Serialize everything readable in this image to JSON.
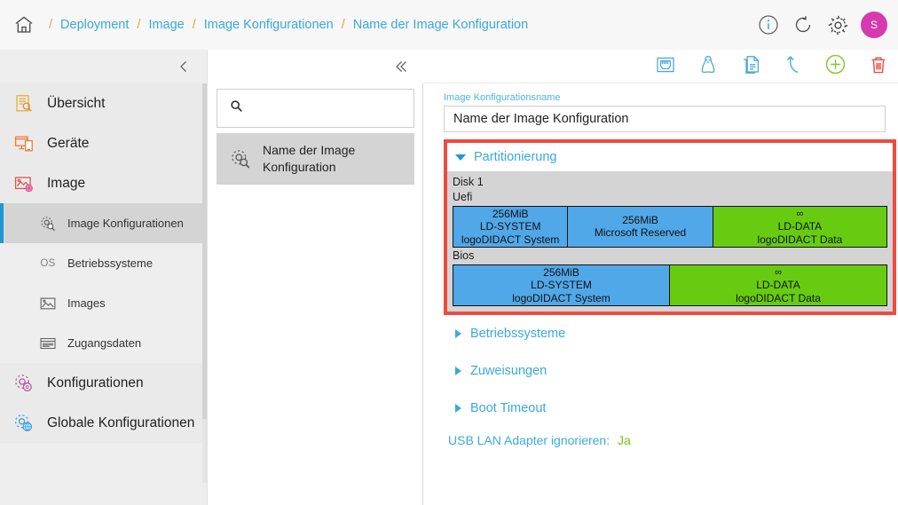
{
  "topbar": {
    "home_icon": "home-icon",
    "breadcrumbs": [
      {
        "label": "Deployment"
      },
      {
        "label": "Image"
      },
      {
        "label": "Image Konfigurationen"
      },
      {
        "label": "Name der Image Konfiguration"
      }
    ],
    "separator": "/",
    "actions": [
      {
        "icon": "info-icon"
      },
      {
        "icon": "refresh-icon"
      },
      {
        "icon": "gear-icon"
      }
    ],
    "avatar_initial": "S",
    "avatar_color": "#d63ab0"
  },
  "sidebar": {
    "collapse_icon": "chevron-left-icon",
    "items": [
      {
        "label": "Übersicht",
        "icon": "overview-document-search-icon",
        "level": "top"
      },
      {
        "label": "Geräte",
        "icon": "devices-monitor-phone-icon",
        "level": "top"
      },
      {
        "label": "Image",
        "icon": "image-gear-icon",
        "level": "top"
      },
      {
        "label": "Image Konfigurationen",
        "icon": "gear-search-icon",
        "level": "sub",
        "active": true
      },
      {
        "label": "Betriebssysteme",
        "icon": "os-text-icon",
        "level": "sub",
        "active": false
      },
      {
        "label": "Images",
        "icon": "picture-frame-icon",
        "level": "sub",
        "active": false
      },
      {
        "label": "Zugangsdaten",
        "icon": "credentials-card-icon",
        "level": "sub",
        "active": false
      },
      {
        "label": "Konfigurationen",
        "icon": "config-gear-icon",
        "level": "top"
      },
      {
        "label": "Globale Konfigurationen",
        "icon": "global-gear-globe-icon",
        "level": "top"
      }
    ]
  },
  "list_panel": {
    "collapse_icon": "chevron-left-icon",
    "search": {
      "icon": "search-icon",
      "value": "",
      "placeholder": ""
    },
    "items": [
      {
        "label": "Name der Image Konfiguration",
        "icon": "gear-search-icon",
        "selected": true
      }
    ]
  },
  "main": {
    "back_icon": "chevron-left-icon",
    "toolbar_icons": [
      {
        "icon": "network-port-icon",
        "color": "#4aa8dd"
      },
      {
        "icon": "linux-penguin-icon",
        "color": "#4aa8dd"
      },
      {
        "icon": "copy-documents-icon",
        "color": "#4aa8dd"
      },
      {
        "icon": "undo-arrow-icon",
        "color": "#4aa8dd"
      },
      {
        "icon": "plus-circle-icon",
        "color": "#86c53a"
      },
      {
        "icon": "trash-icon",
        "color": "#ef4a42"
      }
    ],
    "name_field": {
      "label": "Image Konfigurationsname",
      "value": "Name der Image Konfiguration",
      "placeholder": ""
    },
    "partition_section": {
      "title": "Partitionierung",
      "expanded": true,
      "highlight_color": "#f04a3f",
      "disk_label": "Disk 1",
      "layouts": [
        {
          "mode": "Uefi",
          "partitions": [
            {
              "size": "256MiB",
              "name": "LD-SYSTEM",
              "desc": "logoDIDACT System",
              "color": "blue",
              "width_pct": 26.5
            },
            {
              "size": "256MiB",
              "name": "",
              "desc": "Microsoft Reserved",
              "color": "blue",
              "width_pct": 33.5
            },
            {
              "size": "∞",
              "name": "LD-DATA",
              "desc": "logoDIDACT Data",
              "color": "green",
              "width_pct": 40.0
            }
          ]
        },
        {
          "mode": "Bios",
          "partitions": [
            {
              "size": "256MiB",
              "name": "LD-SYSTEM",
              "desc": "logoDIDACT System",
              "color": "blue",
              "width_pct": 50.0
            },
            {
              "size": "∞",
              "name": "LD-DATA",
              "desc": "logoDIDACT Data",
              "color": "green",
              "width_pct": 50.0
            }
          ]
        }
      ]
    },
    "collapsed_sections": [
      {
        "title": "Betriebssysteme"
      },
      {
        "title": "Zuweisungen"
      },
      {
        "title": "Boot Timeout"
      }
    ],
    "settings_row": {
      "key": "USB LAN Adapter ignorieren:",
      "value": "Ja"
    }
  }
}
